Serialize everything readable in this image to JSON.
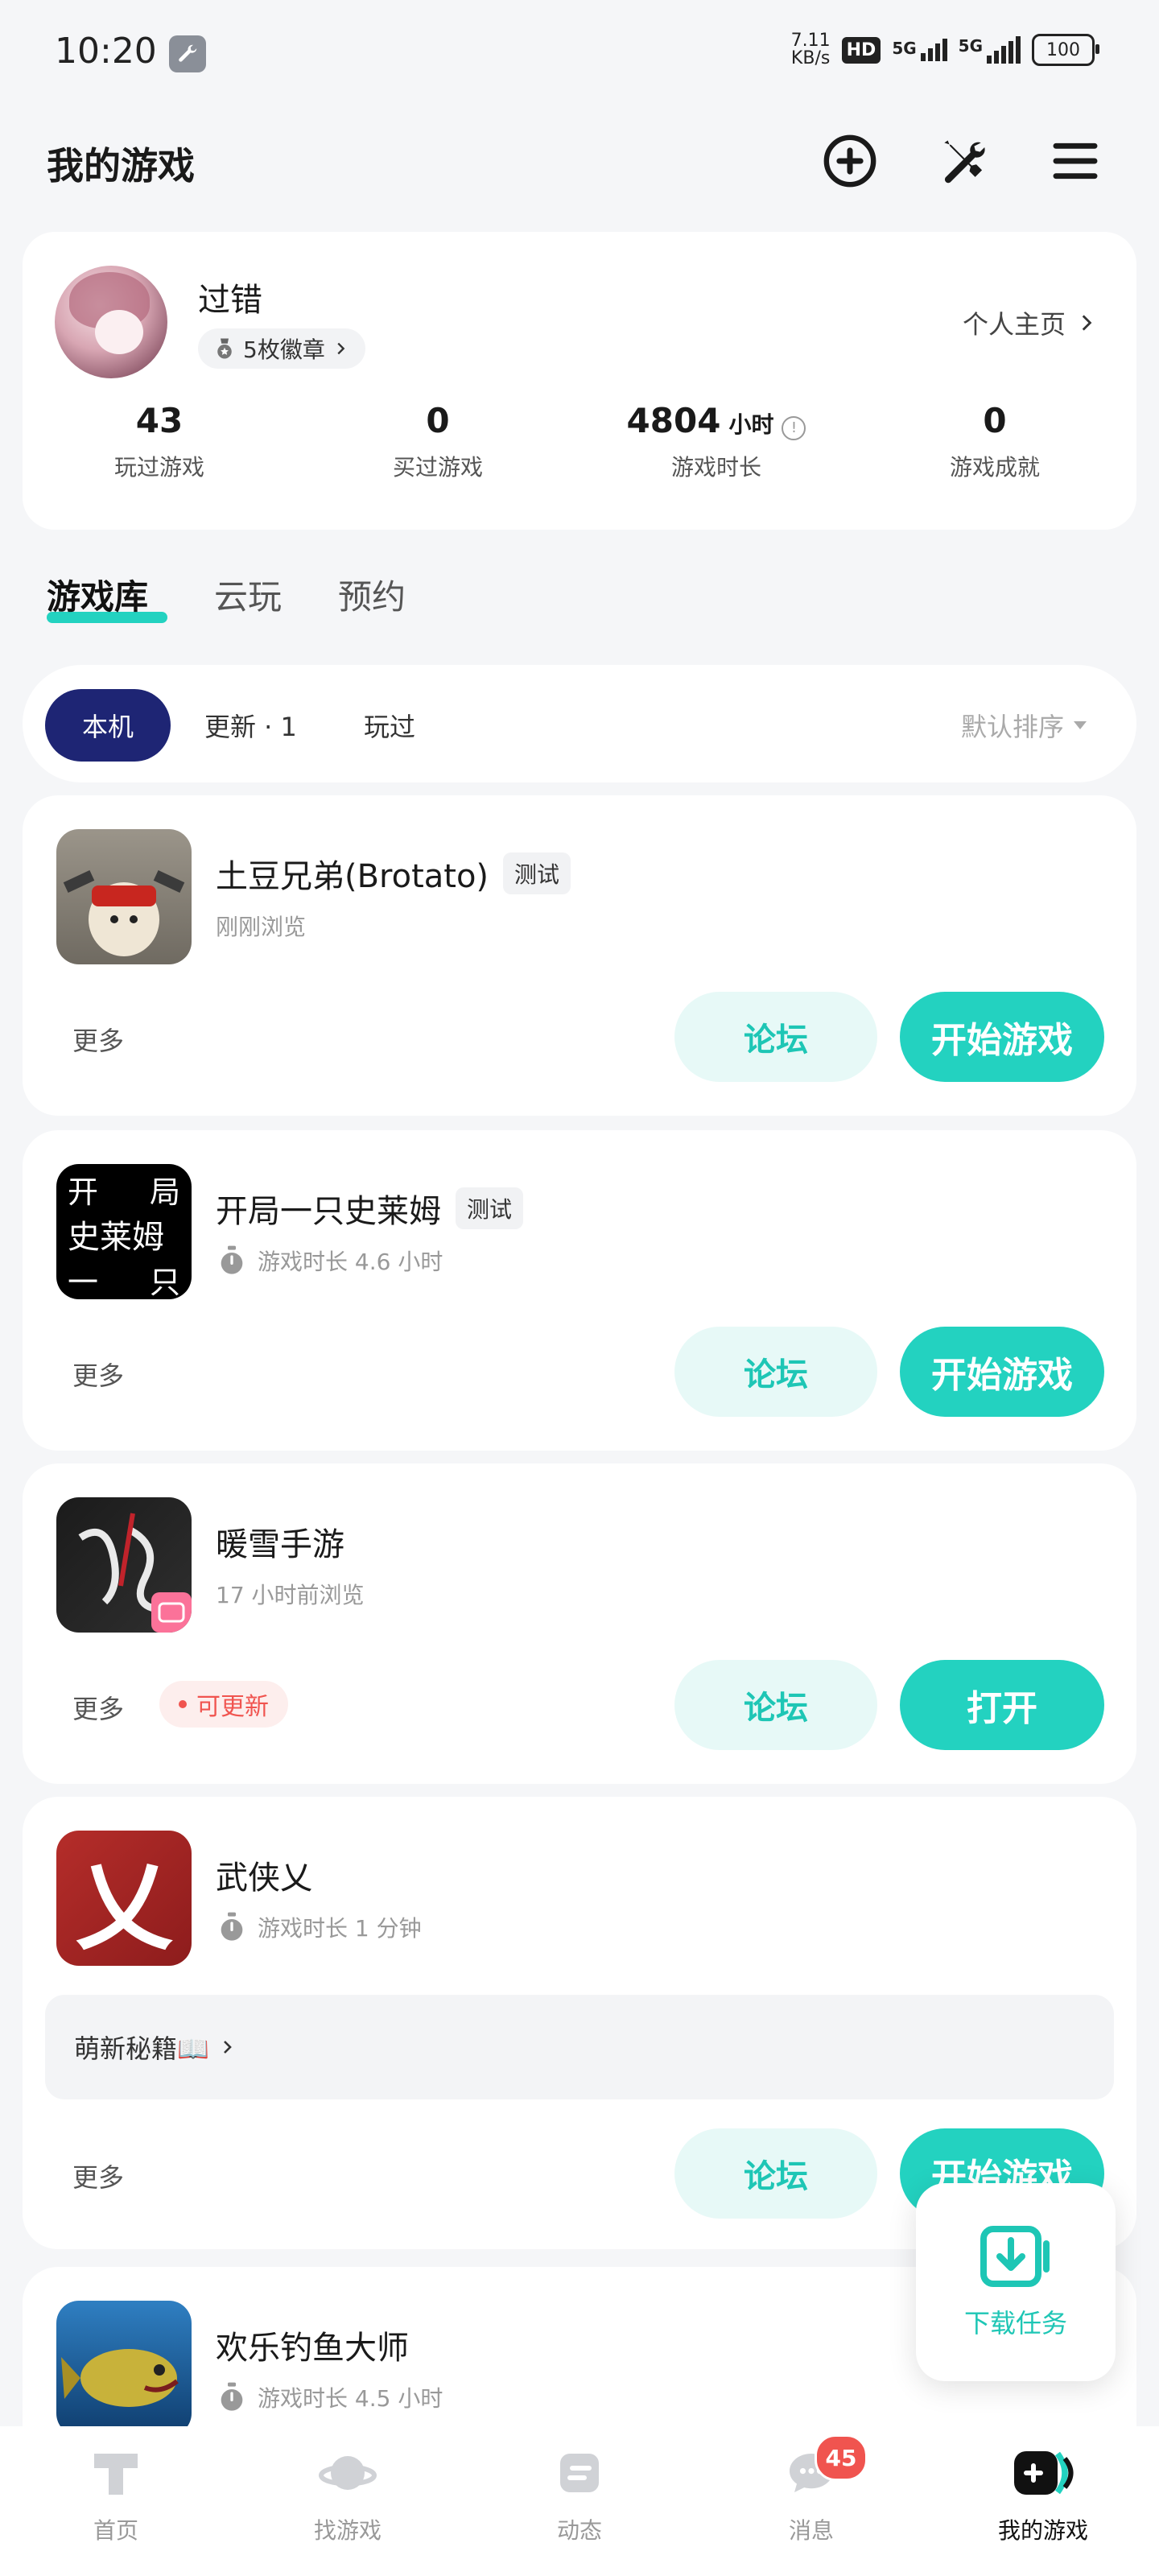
{
  "status_bar": {
    "time": "10:20",
    "speed_value": "7.11",
    "speed_unit": "KB/s",
    "hd_label": "HD",
    "net1": "5G",
    "net2": "5G",
    "battery": "100"
  },
  "header": {
    "title": "我的游戏"
  },
  "profile": {
    "username": "过错",
    "badges": "5枚徽章",
    "home_link": "个人主页",
    "stats": [
      {
        "value": "43",
        "unit": "",
        "label": "玩过游戏"
      },
      {
        "value": "0",
        "unit": "",
        "label": "买过游戏"
      },
      {
        "value": "4804",
        "unit": "小时",
        "label": "游戏时长"
      },
      {
        "value": "0",
        "unit": "",
        "label": "游戏成就"
      }
    ]
  },
  "tabs": [
    "游戏库",
    "云玩",
    "预约"
  ],
  "filters": {
    "local": "本机",
    "update": "更新 · 1",
    "played": "玩过",
    "sort": "默认排序"
  },
  "games": [
    {
      "name": "土豆兄弟(Brotato)",
      "tag": "测试",
      "sub": "刚刚浏览",
      "more": "更多",
      "forum": "论坛",
      "action": "开始游戏"
    },
    {
      "name": "开局一只史莱姆",
      "tag": "测试",
      "sub": "游戏时长 4.6 小时",
      "more": "更多",
      "forum": "论坛",
      "action": "开始游戏",
      "icon_text": [
        "开",
        "局",
        "史莱姆",
        "一",
        "只"
      ]
    },
    {
      "name": "暖雪手游",
      "sub": "17 小时前浏览",
      "more": "更多",
      "update": "可更新",
      "forum": "论坛",
      "action": "打开"
    },
    {
      "name": "武侠乂",
      "sub": "游戏时长 1 分钟",
      "tips": "萌新秘籍📖",
      "more": "更多",
      "forum": "论坛",
      "action": "开始游戏",
      "icon_text": "乂"
    },
    {
      "name": "欢乐钓鱼大师",
      "sub": "游戏时长 4.5 小时"
    }
  ],
  "download": {
    "label": "下载任务"
  },
  "bottom_nav": [
    {
      "label": "首页"
    },
    {
      "label": "找游戏"
    },
    {
      "label": "动态"
    },
    {
      "label": "消息",
      "badge": "45"
    },
    {
      "label": "我的游戏"
    }
  ],
  "colors": {
    "accent": "#23d2c0",
    "accent_text": "#1ec6b5",
    "dark_pill": "#1e2574",
    "alert": "#f0544f"
  }
}
